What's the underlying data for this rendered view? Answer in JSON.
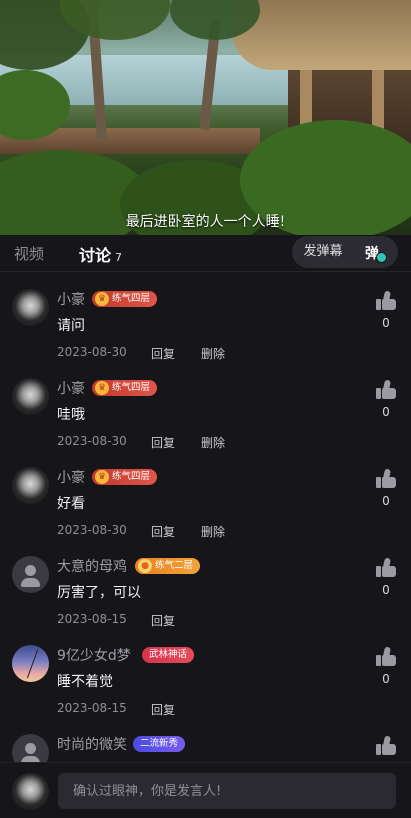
{
  "video": {
    "subtitle": "最后进卧室的人一个人睡!"
  },
  "tabs": {
    "video_label": "视频",
    "discuss_label": "讨论",
    "discuss_count": "7",
    "danmu_button": "发弹幕",
    "danmu_toggle_label": "弹"
  },
  "comments": [
    {
      "user": "小豪",
      "badge": "练气四层",
      "text": "请问",
      "date": "2023-08-30",
      "reply": "回复",
      "delete": "删除",
      "likes": "0"
    },
    {
      "user": "小豪",
      "badge": "练气四层",
      "text": "哇哦",
      "date": "2023-08-30",
      "reply": "回复",
      "delete": "删除",
      "likes": "0"
    },
    {
      "user": "小豪",
      "badge": "练气四层",
      "text": "好看",
      "date": "2023-08-30",
      "reply": "回复",
      "delete": "删除",
      "likes": "0"
    },
    {
      "user": "大意的母鸡",
      "badge": "练气二层",
      "text": "厉害了，可以",
      "date": "2023-08-15",
      "reply": "回复",
      "likes": "0"
    },
    {
      "user": "9亿少女d梦",
      "badge": "武林神话",
      "text": "睡不着觉",
      "date": "2023-08-15",
      "reply": "回复",
      "likes": "0"
    },
    {
      "user": "时尚的微笑",
      "badge": "二流新秀"
    }
  ],
  "input": {
    "placeholder": "确认过眼神，你是发言人!"
  },
  "colors": {
    "background": "#16161a",
    "badge_red": "#c0392b",
    "badge_orange": "#e8811f",
    "badge_purple": "#4b4be0",
    "danmu_check": "#2ec4b6"
  }
}
